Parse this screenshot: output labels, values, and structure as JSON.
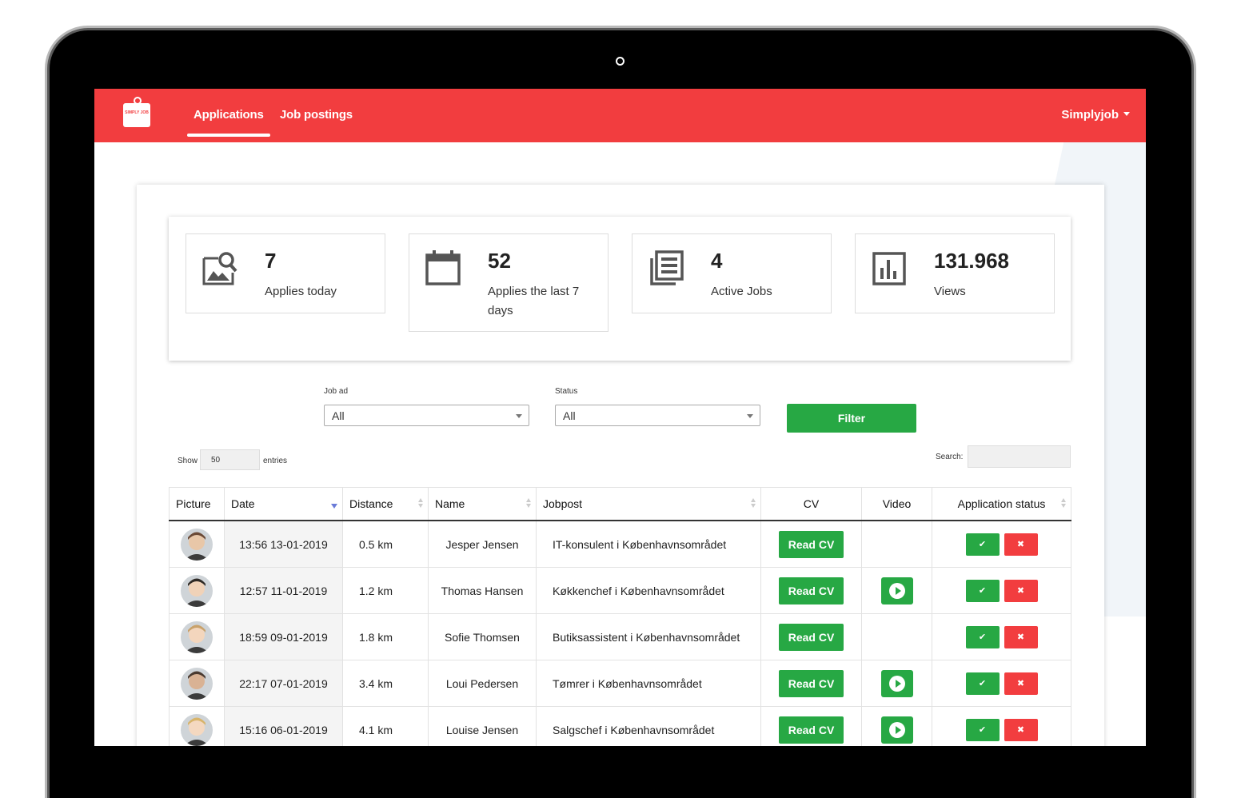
{
  "header": {
    "logo_text": "SIMPLY JOB",
    "nav": [
      {
        "label": "Applications",
        "active": true
      },
      {
        "label": "Job postings",
        "active": false
      }
    ],
    "user_menu": "Simplyjob",
    "brand_color": "#f23d3f"
  },
  "stats": [
    {
      "icon": "image-search-icon",
      "value": "7",
      "label": "Applies today"
    },
    {
      "icon": "calendar-icon",
      "value": "52",
      "label": "Applies the last 7 days"
    },
    {
      "icon": "newspaper-icon",
      "value": "4",
      "label": "Active Jobs"
    },
    {
      "icon": "bar-chart-icon",
      "value": "131.968",
      "label": "Views"
    }
  ],
  "filters": {
    "job_ad_label": "Job ad",
    "job_ad_value": "All",
    "status_label": "Status",
    "status_value": "All",
    "filter_button": "Filter"
  },
  "table_controls": {
    "show_label": "Show",
    "show_value": "50",
    "entries_label": "entries",
    "search_label": "Search:"
  },
  "table": {
    "columns": [
      "Picture",
      "Date",
      "Distance",
      "Name",
      "Jobpost",
      "CV",
      "Video",
      "Application status"
    ],
    "read_cv_label": "Read CV",
    "approve_glyph": "✔",
    "reject_glyph": "✖",
    "rows": [
      {
        "date": "13:56 13-01-2019",
        "distance": "0.5 km",
        "name": "Jesper Jensen",
        "jobpost": "IT-konsulent i Københavnsområdet",
        "has_video": false
      },
      {
        "date": "12:57 11-01-2019",
        "distance": "1.2 km",
        "name": "Thomas Hansen",
        "jobpost": "Køkkenchef i Københavnsområdet",
        "has_video": true
      },
      {
        "date": "18:59 09-01-2019",
        "distance": "1.8 km",
        "name": "Sofie Thomsen",
        "jobpost": "Butiksassistent i Københavnsområdet",
        "has_video": false
      },
      {
        "date": "22:17 07-01-2019",
        "distance": "3.4 km",
        "name": "Loui Pedersen",
        "jobpost": "Tømrer i Københavnsområdet",
        "has_video": true
      },
      {
        "date": "15:16 06-01-2019",
        "distance": "4.1 km",
        "name": "Louise Jensen",
        "jobpost": "Salgschef i Københavnsområdet",
        "has_video": true
      }
    ]
  }
}
